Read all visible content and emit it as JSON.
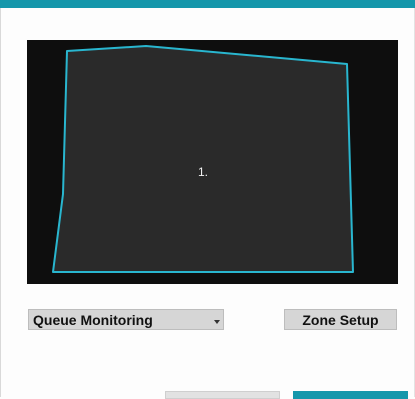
{
  "colors": {
    "accent": "#1597ab",
    "zone_outline": "#29b6cf",
    "zone_fill": "#2a2a2a",
    "preview_background": "#0e0e0e"
  },
  "preview": {
    "zone_number": "1."
  },
  "controls": {
    "mode_select": {
      "value": "Queue Monitoring"
    },
    "zone_setup_label": "Zone Setup"
  }
}
